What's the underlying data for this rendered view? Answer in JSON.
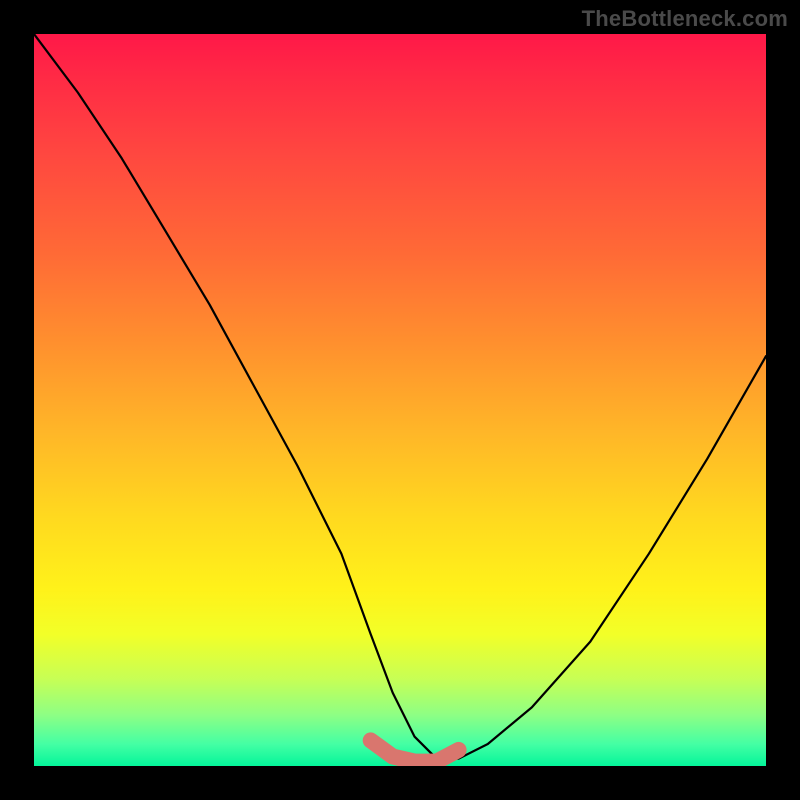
{
  "watermark": "TheBottleneck.com",
  "colors": {
    "page_bg": "#000000",
    "curve": "#000000",
    "band": "#d9766e",
    "gradient_top": "#ff1848",
    "gradient_bottom": "#04f59a",
    "watermark": "#4a4a4a"
  },
  "chart_data": {
    "type": "line",
    "title": "",
    "xlabel": "",
    "ylabel": "",
    "xlim": [
      0,
      100
    ],
    "ylim": [
      0,
      100
    ],
    "grid": false,
    "legend": false,
    "annotations": [
      "TheBottleneck.com"
    ],
    "series": [
      {
        "name": "bottleneck-curve",
        "x": [
          0,
          6,
          12,
          18,
          24,
          30,
          36,
          42,
          46,
          49,
          52,
          55,
          58,
          62,
          68,
          76,
          84,
          92,
          100
        ],
        "y": [
          100,
          92,
          83,
          73,
          63,
          52,
          41,
          29,
          18,
          10,
          4,
          1,
          1,
          3,
          8,
          17,
          29,
          42,
          56
        ]
      }
    ],
    "highlight_band": {
      "x": [
        46,
        49,
        52,
        55,
        58
      ],
      "y": [
        3.5,
        1.3,
        0.6,
        0.6,
        2.2
      ]
    },
    "background_gradient": {
      "orientation": "vertical",
      "stops": [
        {
          "pos": 0.0,
          "color": "#ff1848"
        },
        {
          "pos": 0.3,
          "color": "#ff6a36"
        },
        {
          "pos": 0.66,
          "color": "#ffd91f"
        },
        {
          "pos": 0.88,
          "color": "#c8ff54"
        },
        {
          "pos": 1.0,
          "color": "#04f59a"
        }
      ]
    }
  }
}
